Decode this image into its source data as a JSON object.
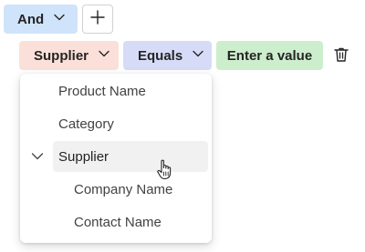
{
  "filter": {
    "logic_label": "And",
    "field_label": "Supplier",
    "operator_label": "Equals",
    "value_label": "Enter a value"
  },
  "menu": {
    "items": [
      {
        "label": "Product Name"
      },
      {
        "label": "Category"
      },
      {
        "label": "Supplier",
        "expanded": true,
        "selected": true
      },
      {
        "label": "Company Name"
      },
      {
        "label": "Contact Name"
      }
    ]
  },
  "icons": [
    "chevron-down-icon",
    "plus-icon",
    "trash-icon",
    "chevron-down-icon",
    "hand-pointer-icon"
  ],
  "colors": {
    "logic_bg": "#cfe4fa",
    "field_bg": "#fbe0d9",
    "operator_bg": "#d6dcf7",
    "value_bg": "#cdeecd",
    "selected_item_bg": "#f1f1f1"
  }
}
